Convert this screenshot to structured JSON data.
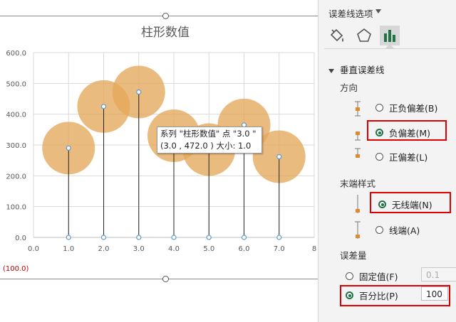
{
  "chart_data": {
    "type": "scatter",
    "title": "柱形数值",
    "x": [
      1.0,
      2.0,
      3.0,
      4.0,
      5.0,
      6.0,
      7.0
    ],
    "y": [
      290,
      425,
      472,
      330,
      285,
      365,
      262
    ],
    "xlim": [
      0,
      8
    ],
    "ylim": [
      0,
      600
    ],
    "x_ticks": [
      "0.0",
      "1.0",
      "2.0",
      "3.0",
      "4.0",
      "5.0",
      "6.0",
      "7.0",
      "8"
    ],
    "y_ticks": [
      "0.0",
      "100.0",
      "200.0",
      "300.0",
      "400.0",
      "500.0",
      "600.0"
    ],
    "bubble_size": 1.0,
    "error_bars": "vertical minus, 100%, no cap",
    "grid": true,
    "clipped_label": "(100.0)",
    "colors": {
      "bubble": "#e4a85a",
      "marker": "#5b9bd5",
      "clipped_label": "#c00000"
    }
  },
  "tooltip": {
    "line1": "系列 \"柱形数值\" 点 \"3.0 \"",
    "line2": "(3.0 , 472.0 ) 大小: 1.0"
  },
  "panel": {
    "title": "误差线选项",
    "tabs": [
      "fill-line-icon",
      "effects-pentagon-icon",
      "bar-chart-icon"
    ],
    "section": "垂直误差线",
    "direction_label": "方向",
    "direction_options": [
      {
        "label": "正负偏差(B)",
        "checked": false
      },
      {
        "label": "负偏差(M)",
        "checked": true
      },
      {
        "label": "正偏差(L)",
        "checked": false
      }
    ],
    "end_style_label": "末端样式",
    "end_style_options": [
      {
        "label": "无线端(N)",
        "checked": true
      },
      {
        "label": "线端(A)",
        "checked": false
      }
    ],
    "amount_label": "误差量",
    "fixed_value_label": "固定值(F)",
    "fixed_value": "0.1",
    "percentage_label": "百分比(P)",
    "percentage_value": "100",
    "accent": "#217346",
    "highlight": "#e00000"
  }
}
